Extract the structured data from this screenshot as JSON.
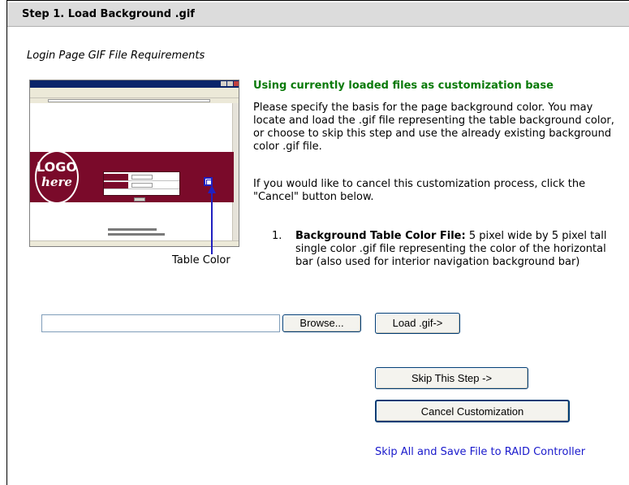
{
  "header": {
    "title": "Step 1. Load Background .gif"
  },
  "requirements": {
    "title": "Login Page GIF File Requirements"
  },
  "preview": {
    "logo_text": "LOGO",
    "logo_subtext": "here",
    "table_color_label": "Table Color",
    "colors": {
      "banner": "#7a0a2a",
      "marker": "#2020c0"
    }
  },
  "content": {
    "heading": "Using currently loaded files as customization base",
    "paragraph1": "Please specify the basis for the page background color. You may locate and load the .gif file representing the table background color, or choose to skip this step and use the already existing background color .gif file.",
    "paragraph2": "If you would like to cancel this customization process, click the \"Cancel\" button below.",
    "list": [
      {
        "number": "1.",
        "title": "Background Table Color File:",
        "text": " 5 pixel wide by 5 pixel tall single color .gif file representing the color of the horizontal bar (also used for interior navigation background bar)"
      }
    ]
  },
  "form": {
    "file_value": "",
    "browse_label": "Browse...",
    "load_label": "Load .gif->",
    "skip_label": "Skip This Step ->",
    "cancel_label": "Cancel Customization",
    "save_link": "Skip All and Save File to RAID Controller"
  }
}
